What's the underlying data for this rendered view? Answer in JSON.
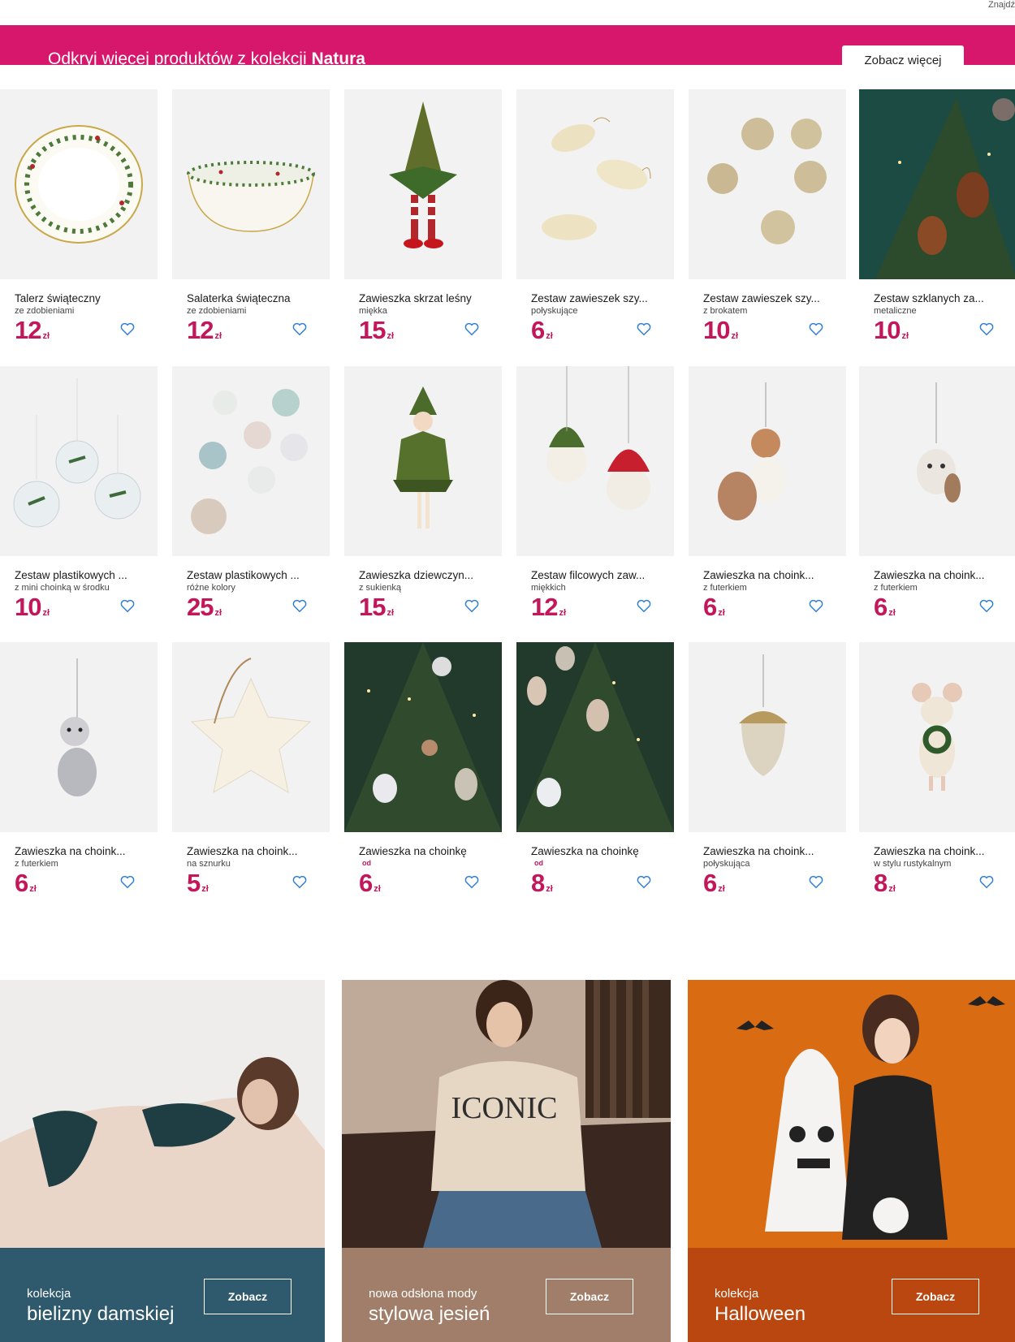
{
  "top_corner_text": "Znajdź",
  "banner": {
    "text_prefix": "Odkryj więcej produktów z kolekcji ",
    "text_brand": "Natura",
    "button_label": "Zobacz więcej",
    "color": "#d6176b"
  },
  "currency": "zł",
  "price_color": "#c2185b",
  "products": [
    {
      "name": "Talerz świąteczny",
      "sub": "ze zdobieniami",
      "price": "12",
      "icon": "plate-image"
    },
    {
      "name": "Salaterka świąteczna",
      "sub": "ze zdobieniami",
      "price": "12",
      "icon": "bowl-image"
    },
    {
      "name": "Zawieszka skrzat leśny",
      "sub": "miękka",
      "price": "15",
      "icon": "gnome-ornament-image"
    },
    {
      "name": "Zestaw zawieszek szy...",
      "sub": "połyskujące",
      "price": "6",
      "icon": "glass-cones-image"
    },
    {
      "name": "Zestaw zawieszek szy...",
      "sub": "z brokatem",
      "price": "10",
      "icon": "glitter-balls-image"
    },
    {
      "name": "Zestaw szklanych za...",
      "sub": "metaliczne",
      "price": "10",
      "icon": "tree-squirrel-image"
    },
    {
      "name": "Zestaw plastikowych ...",
      "sub": "z mini choinką w środku",
      "price": "10",
      "icon": "clear-baubles-image"
    },
    {
      "name": "Zestaw plastikowych ...",
      "sub": "różne kolory",
      "price": "25",
      "icon": "pastel-baubles-image"
    },
    {
      "name": "Zawieszka dziewczyn...",
      "sub": "z sukienką",
      "price": "15",
      "icon": "girl-ornament-image"
    },
    {
      "name": "Zestaw filcowych zaw...",
      "sub": "miękkich",
      "price": "12",
      "icon": "felt-birds-image"
    },
    {
      "name": "Zawieszka na choink...",
      "sub": "z futerkiem",
      "price": "6",
      "icon": "squirrel-ornament-image"
    },
    {
      "name": "Zawieszka na choink...",
      "sub": "z futerkiem",
      "price": "6",
      "icon": "owl-ornament-image"
    },
    {
      "name": "Zawieszka na choink...",
      "sub": "z futerkiem",
      "price": "6",
      "icon": "raccoon-ornament-image"
    },
    {
      "name": "Zawieszka na choink...",
      "sub": "na sznurku",
      "price": "5",
      "icon": "star-ornament-image"
    },
    {
      "name": "Zawieszka na choinkę",
      "od": "od",
      "price": "6",
      "icon": "tree-ornaments-image"
    },
    {
      "name": "Zawieszka na choinkę",
      "od": "od",
      "price": "8",
      "icon": "tree-mice-image"
    },
    {
      "name": "Zawieszka na choink...",
      "sub": "połyskująca",
      "price": "6",
      "icon": "acorn-ornament-image"
    },
    {
      "name": "Zawieszka na choink...",
      "sub": "w stylu rustykalnym",
      "price": "8",
      "icon": "mouse-ornament-image"
    }
  ],
  "promos": [
    {
      "small": "kolekcja",
      "big": "bielizny damskiej",
      "button": "Zobacz",
      "color": "#2f5a6d"
    },
    {
      "small": "nowa odsłona mody",
      "big": "stylowa jesień",
      "button": "Zobacz",
      "color": "#a07e69"
    },
    {
      "small": "kolekcja",
      "big": "Halloween",
      "button": "Zobacz",
      "color": "#b9470f"
    }
  ]
}
